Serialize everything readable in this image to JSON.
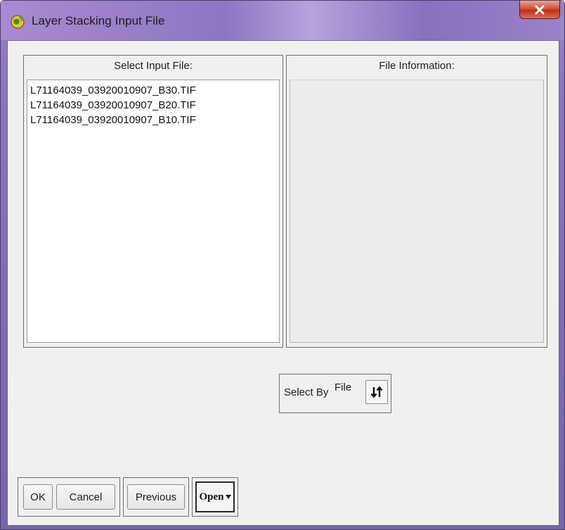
{
  "window": {
    "title": "Layer Stacking Input File",
    "close_glyph": "x"
  },
  "left_panel": {
    "header": "Select Input File:",
    "files": [
      "L71164039_03920010907_B30.TIF",
      "L71164039_03920010907_B20.TIF",
      "L71164039_03920010907_B10.TIF"
    ]
  },
  "right_panel": {
    "header": "File Information:"
  },
  "select_by": {
    "label": "Select By",
    "value": "File",
    "sort_icon": "sort-arrows-icon"
  },
  "buttons": {
    "ok": "OK",
    "cancel": "Cancel",
    "previous": "Previous",
    "open": "Open"
  },
  "icons": {
    "app": "app-globe-icon",
    "close": "close-icon",
    "dropdown": "dropdown-arrow-icon"
  }
}
